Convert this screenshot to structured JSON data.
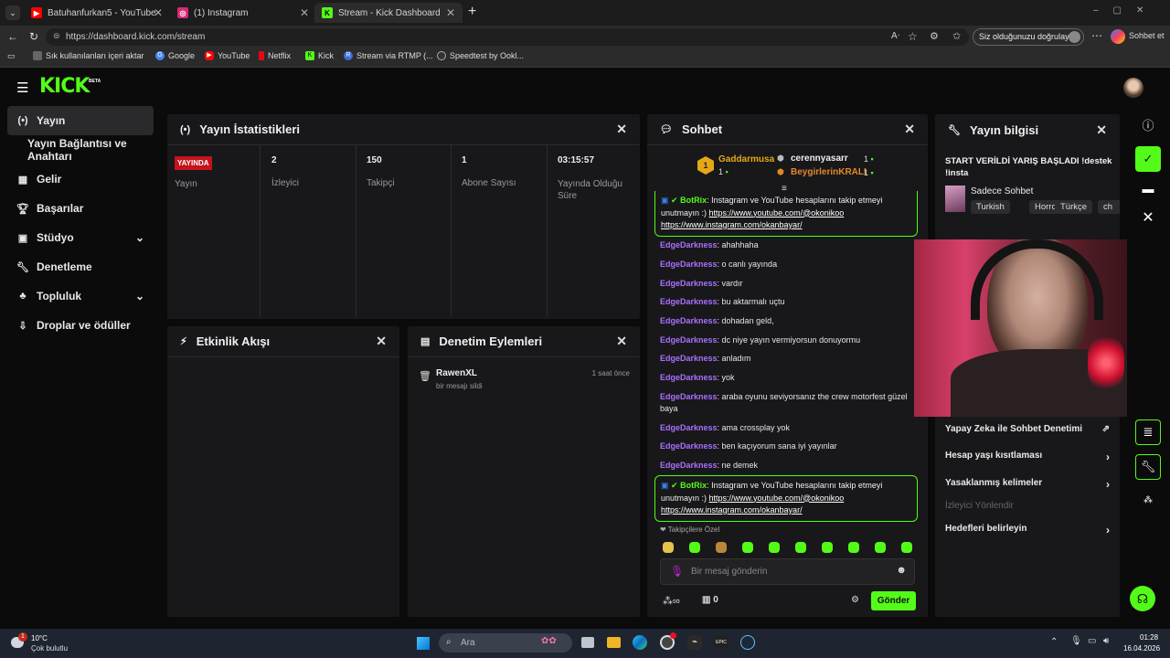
{
  "browser": {
    "tabs": [
      {
        "title": "Batuhanfurkan5 - YouTube",
        "icon": "youtube-icon",
        "color": "#ff0000"
      },
      {
        "title": "(1) Instagram",
        "icon": "instagram-icon",
        "color": "#d62976"
      },
      {
        "title": "Stream - Kick Dashboard",
        "icon": "kick-icon",
        "color": "#53fc18"
      }
    ],
    "url": "https://dashboard.kick.com/stream",
    "verify_label": "Siz olduğunuzu doğrulayın",
    "copilot_label": "Sohbet et",
    "bookmarks": [
      "Sık kullanılanları içeri aktar",
      "Google",
      "YouTube",
      "Netflix",
      "Kick",
      "Stream via RTMP (...",
      "Speedtest by Ookl..."
    ]
  },
  "logo": {
    "text": "KICK",
    "beta": "BETA"
  },
  "sidebar": {
    "items": [
      {
        "label": "Yayın",
        "icon": "broadcast-icon"
      },
      {
        "label": "Yayın Bağlantısı ve Anahtarı",
        "icon": ""
      },
      {
        "label": "Gelir",
        "icon": "wallet-icon"
      },
      {
        "label": "Başarılar",
        "icon": "trophy-icon"
      },
      {
        "label": "Stüdyo",
        "icon": "studio-icon"
      },
      {
        "label": "Denetleme",
        "icon": "wrench-icon"
      },
      {
        "label": "Topluluk",
        "icon": "community-icon"
      },
      {
        "label": "Droplar ve ödüller",
        "icon": "drops-icon"
      }
    ]
  },
  "stats": {
    "title": "Yayın İstatistikleri",
    "items": [
      {
        "value": "YAYINDA",
        "label": "Yayın"
      },
      {
        "value": "2",
        "label": "İzleyici"
      },
      {
        "value": "150",
        "label": "Takipçi"
      },
      {
        "value": "1",
        "label": "Abone Sayısı"
      },
      {
        "value": "03:15:57",
        "label": "Yayında Olduğu Süre"
      }
    ]
  },
  "activity": {
    "title": "Etkinlik Akışı"
  },
  "moderation": {
    "title": "Denetim Eylemleri",
    "entries": [
      {
        "user": "RawenXL",
        "action": "bir mesajı sildi",
        "time": "1 saat önce"
      }
    ]
  },
  "chat": {
    "title": "Sohbet",
    "leaderboard": [
      {
        "rank": "1",
        "name": "Gaddarmusa",
        "count": "1"
      },
      {
        "name": "cerennyasarr",
        "count": "1"
      },
      {
        "name": "BeygirlerinKRALI",
        "count": "1"
      }
    ],
    "bot_message": {
      "user": "BotRix",
      "text": ": Instagram ve YouTube hesaplarını takip etmeyi unutmayın :) ",
      "link1": "https://www.youtube.com/@okonikoo",
      "link2": "https://www.instagram.com/okanbayar/"
    },
    "messages": [
      {
        "user": "EdgeDarkness",
        "text": ": ahahhaha"
      },
      {
        "user": "EdgeDarkness",
        "text": ": o canlı yayında"
      },
      {
        "user": "EdgeDarkness",
        "text": ": vardır"
      },
      {
        "user": "EdgeDarkness",
        "text": ": bu aktarmalı uçtu"
      },
      {
        "user": "EdgeDarkness",
        "text": ": dohadan geld,"
      },
      {
        "user": "EdgeDarkness",
        "text": ": dc niye yayın vermiyorsun donuyormu"
      },
      {
        "user": "EdgeDarkness",
        "text": ": anladım"
      },
      {
        "user": "EdgeDarkness",
        "text": ": yok"
      },
      {
        "user": "EdgeDarkness",
        "text": ": araba oyunu seviyorsanız the crew motorfest güzel baya"
      },
      {
        "user": "EdgeDarkness",
        "text": ": ama crossplay yok"
      },
      {
        "user": "EdgeDarkness",
        "text": ": ben kaçıyorum sana iyi yayınlar"
      },
      {
        "user": "EdgeDarkness",
        "text": ": ne demek"
      }
    ],
    "emote_section": "Takipçilere Özel",
    "input_placeholder": "Bir mesaj gönderin",
    "points": "∞",
    "gift_count": "0",
    "send_label": "Gönder"
  },
  "stream_info": {
    "title": "Yayın bilgisi",
    "stream_title": "START VERİLDİ YARIŞ BAŞLADI !destek !insta",
    "category": "Sadece Sohbet",
    "tags": [
      "Turkish",
      "Horror",
      "Türkçe",
      "ch"
    ]
  },
  "settings": {
    "items": [
      {
        "label": "Yapay Zeka ile Sohbet Denetimi"
      },
      {
        "label": "Hesap yaşı kısıtlaması"
      },
      {
        "label": "Yasaklanmış kelimeler"
      },
      {
        "label": "İzleyici Yönlendir"
      },
      {
        "label": "Hedefleri belirleyin"
      }
    ]
  },
  "taskbar": {
    "weather_temp": "10°C",
    "weather_desc": "Çok bulutlu",
    "search_placeholder": "Ara",
    "time": "01:28",
    "date": "16.04.2026",
    "notif": "1"
  },
  "colors": {
    "accent": "#53fc18",
    "live": "#c4131b",
    "username": "#a970ff"
  }
}
